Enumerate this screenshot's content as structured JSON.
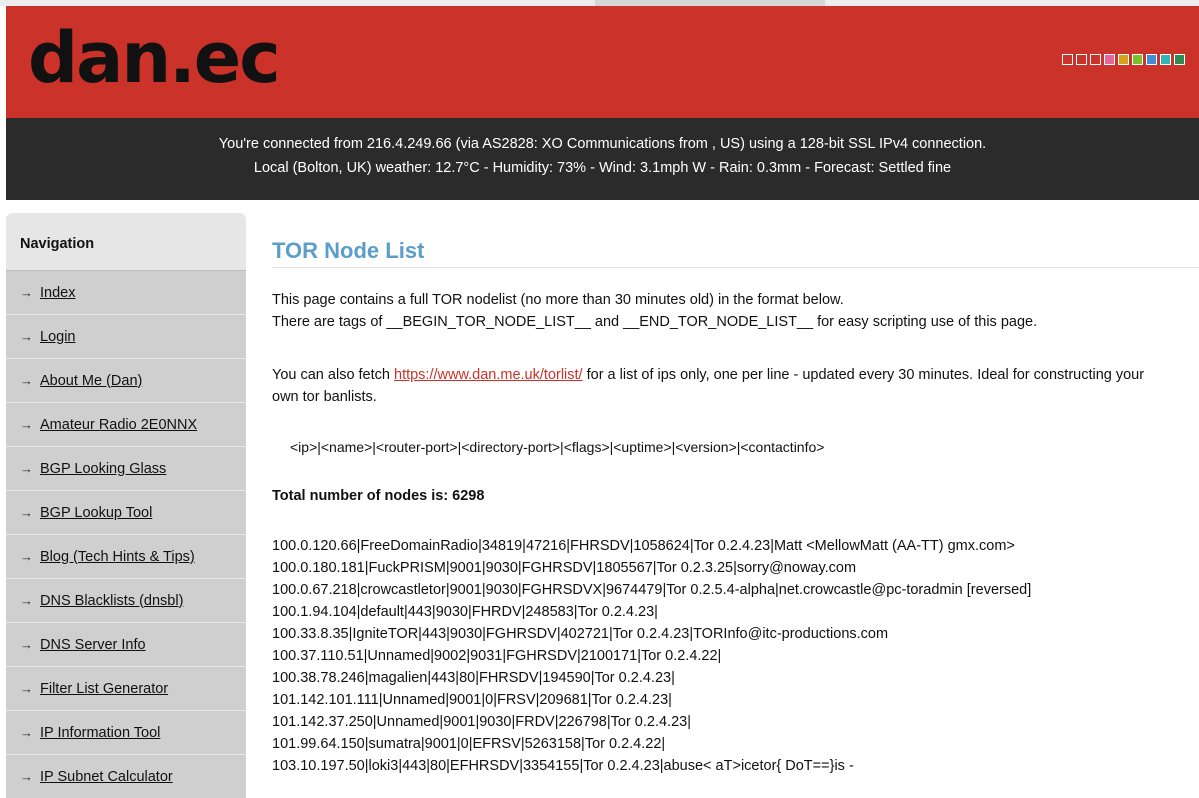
{
  "header": {
    "logo": "dan.ec",
    "swatch_colors": [
      "#cb3229",
      "#cb3229",
      "#cb3229",
      "#e8679b",
      "#d4a21c",
      "#7cbf2b",
      "#3e8fd6",
      "#33b5b5",
      "#2e8b57"
    ]
  },
  "infobar": {
    "line1": "You're connected from 216.4.249.66 (via AS2828: XO Communications from , US) using a 128-bit SSL IPv4 connection.",
    "line2": "Local (Bolton, UK) weather: 12.7°C - Humidity: 73% - Wind: 3.1mph W - Rain: 0.3mm - Forecast: Settled fine"
  },
  "sidebar": {
    "heading": "Navigation",
    "arrow": "→",
    "items": [
      {
        "label": "Index"
      },
      {
        "label": "Login"
      },
      {
        "label": "About Me (Dan)"
      },
      {
        "label": "Amateur Radio 2E0NNX"
      },
      {
        "label": "BGP Looking Glass"
      },
      {
        "label": "BGP Lookup Tool"
      },
      {
        "label": "Blog (Tech Hints & Tips)"
      },
      {
        "label": "DNS Blacklists (dnsbl)"
      },
      {
        "label": "DNS Server Info"
      },
      {
        "label": "Filter List Generator"
      },
      {
        "label": "IP Information Tool"
      },
      {
        "label": "IP Subnet Calculator"
      }
    ]
  },
  "main": {
    "title": "TOR Node List",
    "intro_line1": "This page contains a full TOR nodelist (no more than 30 minutes old) in the format below.",
    "intro_line2": "There are tags of __BEGIN_TOR_NODE_LIST__ and __END_TOR_NODE_LIST__ for easy scripting use of this page.",
    "fetch_prefix": "You can also fetch ",
    "fetch_link": "https://www.dan.me.uk/torlist/",
    "fetch_suffix": " for a list of ips only, one per line - updated every 30 minutes. Ideal for constructing your own tor banlists.",
    "format": "<ip>|<name>|<router-port>|<directory-port>|<flags>|<uptime>|<version>|<contactinfo>",
    "total": "Total number of nodes is: 6298",
    "nodes": [
      "100.0.120.66|FreeDomainRadio|34819|47216|FHRSDV|1058624|Tor 0.2.4.23|Matt <MellowMatt (AA-TT) gmx.com>",
      "100.0.180.181|FuckPRISM|9001|9030|FGHRSDV|1805567|Tor 0.2.3.25|sorry@noway.com",
      "100.0.67.218|crowcastletor|9001|9030|FGHRSDVX|9674479|Tor 0.2.5.4-alpha|net.crowcastle@pc-toradmin [reversed]",
      "100.1.94.104|default|443|9030|FHRDV|248583|Tor 0.2.4.23|",
      "100.33.8.35|IgniteTOR|443|9030|FGHRSDV|402721|Tor 0.2.4.23|TORInfo@itc-productions.com",
      "100.37.110.51|Unnamed|9002|9031|FGHRSDV|2100171|Tor 0.2.4.22|",
      "100.38.78.246|magalien|443|80|FHRSDV|194590|Tor 0.2.4.23|",
      "101.142.101.111|Unnamed|9001|0|FRSV|209681|Tor 0.2.4.23|",
      "101.142.37.250|Unnamed|9001|9030|FRDV|226798|Tor 0.2.4.23|",
      "101.99.64.150|sumatra|9001|0|EFRSV|5263158|Tor 0.2.4.22|",
      "103.10.197.50|loki3|443|80|EFHRSDV|3354155|Tor 0.2.4.23|abuse<    aT>icetor{  DoT==}is -"
    ]
  }
}
